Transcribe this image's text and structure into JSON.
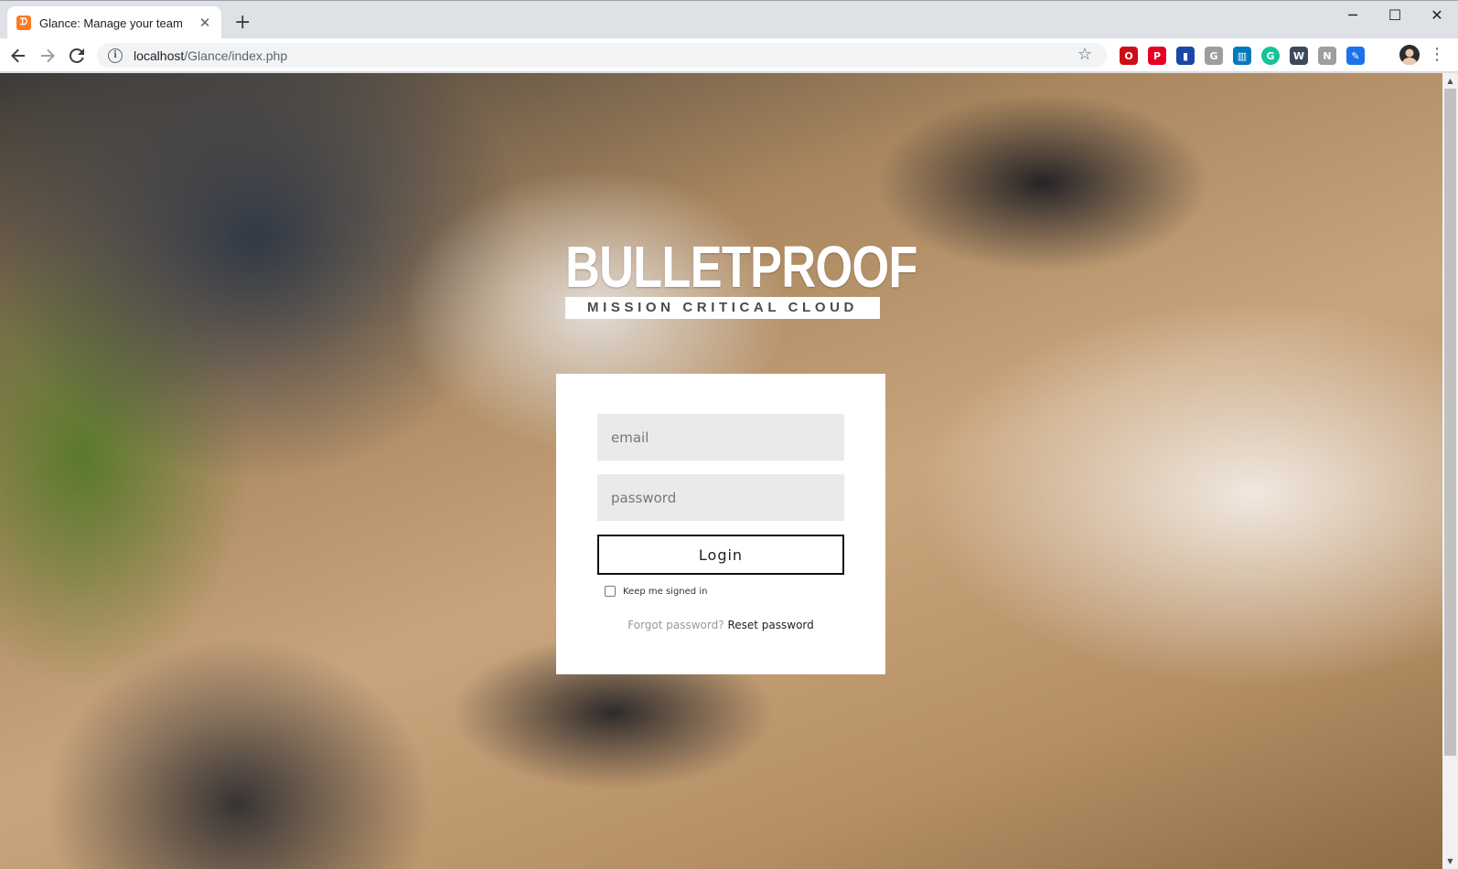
{
  "browser": {
    "tab_title": "Glance: Manage your team",
    "tab_favicon_glyph": "ᗪ",
    "new_tab_glyph": "+",
    "close_glyph": "✕",
    "url_host": "localhost",
    "url_path": "/Glance/index.php",
    "window_controls": {
      "minimize": "─",
      "maximize": "☐",
      "close": "✕"
    },
    "extensions": [
      {
        "name": "opera-icon",
        "glyph": "O",
        "color": "#cc0f16"
      },
      {
        "name": "pinterest-icon",
        "glyph": "P",
        "color": "#e60023"
      },
      {
        "name": "bookmark-icon",
        "glyph": "▮",
        "color": "#1a47a8"
      },
      {
        "name": "grammarly-g-icon",
        "glyph": "G",
        "color": "#9e9e9e"
      },
      {
        "name": "trello-icon",
        "glyph": "▥",
        "color": "#0079bf"
      },
      {
        "name": "grammarly-icon",
        "glyph": "G",
        "color": "#15c39a"
      },
      {
        "name": "wordtune-icon",
        "glyph": "W",
        "color": "#3d4a5a"
      },
      {
        "name": "notion-icon",
        "glyph": "N",
        "color": "#9e9e9e"
      },
      {
        "name": "pen-extension-icon",
        "glyph": "✎",
        "color": "#1a73e8"
      }
    ]
  },
  "page": {
    "logo_main": "BULLETPROOF",
    "logo_sub": "MISSION CRITICAL CLOUD",
    "login": {
      "email_placeholder": "email",
      "password_placeholder": "password",
      "login_label": "Login",
      "keep_signed_in": "Keep me signed in",
      "forgot_text": "Forgot password?",
      "reset_link": "Reset password"
    }
  }
}
